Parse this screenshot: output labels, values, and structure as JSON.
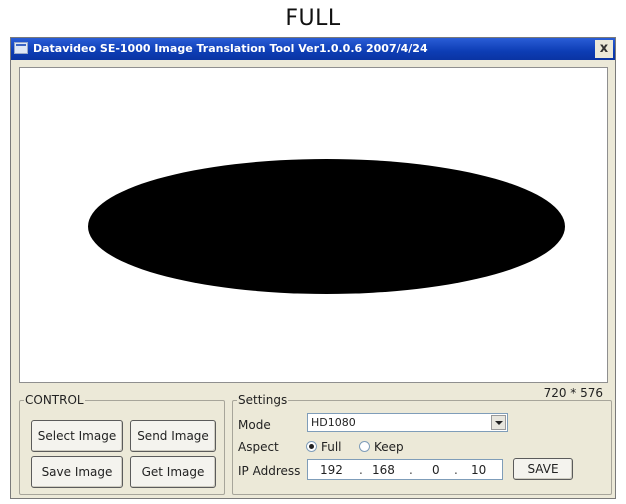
{
  "caption": "FULL",
  "window": {
    "title": "Datavideo SE-1000 Image Translation Tool Ver1.0.0.6 2007/4/24",
    "close_glyph": "x"
  },
  "preview": {
    "resolution": "720 * 576"
  },
  "control": {
    "legend": "CONTROL",
    "select_image": "Select Image",
    "send_image": "Send Image",
    "save_image": "Save Image",
    "get_image": "Get Image"
  },
  "settings": {
    "legend": "Settings",
    "mode_label": "Mode",
    "mode_value": "HD1080",
    "aspect_label": "Aspect",
    "aspect_full": "Full",
    "aspect_keep": "Keep",
    "aspect_selected": "Full",
    "ip_label": "IP Address",
    "ip": [
      "192",
      "168",
      "0",
      "10"
    ],
    "ip_sep": ".",
    "save_label": "SAVE"
  }
}
